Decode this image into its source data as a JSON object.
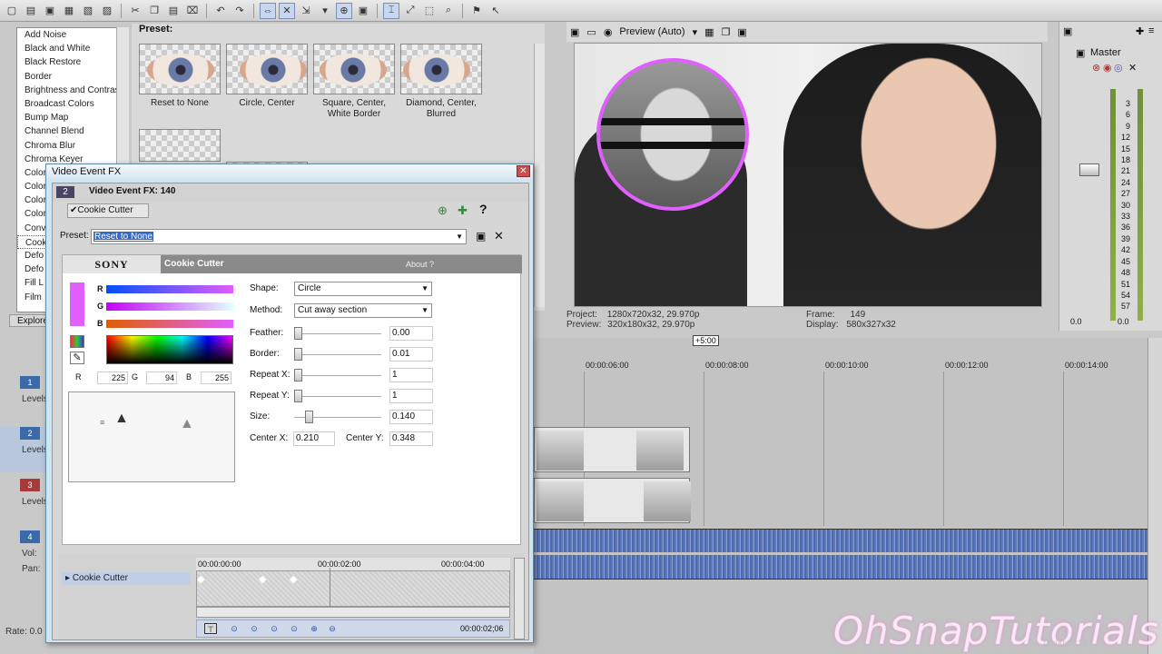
{
  "plugin_list": {
    "items": [
      "Add Noise",
      "Black and White",
      "Black Restore",
      "Border",
      "Brightness and Contrast",
      "Broadcast Colors",
      "Bump Map",
      "Channel Blend",
      "Chroma Blur",
      "Chroma Keyer",
      "Color",
      "Color",
      "Color",
      "Color",
      "Conv",
      "Cook",
      "Defo",
      "Defo",
      "Fill L",
      "Film"
    ],
    "explorer_tab": "Explore"
  },
  "presets": {
    "label": "Preset:",
    "items": [
      {
        "label": "Reset to None"
      },
      {
        "label": "Circle, Center"
      },
      {
        "label": "Square, Center, White Border"
      },
      {
        "label": "Diamond, Center, Blurred"
      }
    ]
  },
  "preview": {
    "mode_label": "Preview (Auto)",
    "project_label": "Project:",
    "project_value": "1280x720x32, 29.970p",
    "preview_label": "Preview:",
    "preview_value": "320x180x32, 29.970p",
    "frame_label": "Frame:",
    "frame_value": "149",
    "display_label": "Display:",
    "display_value": "580x327x32"
  },
  "master": {
    "label": "Master",
    "scale": [
      "3",
      "6",
      "9",
      "12",
      "15",
      "18",
      "21",
      "24",
      "27",
      "30",
      "33",
      "36",
      "39",
      "42",
      "45",
      "48",
      "51",
      "54",
      "57"
    ],
    "bottom_left": "0.0",
    "bottom_right": "0.0"
  },
  "timeline": {
    "cursor_label": "+5:00",
    "ruler": [
      "00:00:06:00",
      "00:00:08:00",
      "00:00:10:00",
      "00:00:12:00",
      "00:00:14:00"
    ],
    "tracks": [
      {
        "num": "1",
        "label": "Levels",
        "color": "#3a6aa8"
      },
      {
        "num": "2",
        "label": "Levels",
        "color": "#3a6aa8"
      },
      {
        "num": "3",
        "label": "Levels",
        "color": "#a83a3a"
      },
      {
        "num": "4",
        "label": "Vol:",
        "label2": "Pan:",
        "color": "#3a6aa8"
      }
    ],
    "rate_label": "Rate: 0.0"
  },
  "dialog": {
    "title": "Video Event FX",
    "close": "✕",
    "chain_num": "2",
    "chain_title": "Video Event FX: 140",
    "plugin_tab": "Cookie Cutter",
    "preset_label": "Preset:",
    "preset_value": "Reset to None",
    "brand": "SONY",
    "plugin_name": "Cookie Cutter",
    "about": "About ?",
    "color": {
      "r": "225",
      "g": "94",
      "b": "255",
      "hex": "#e15eff"
    },
    "params": {
      "shape_label": "Shape:",
      "shape_value": "Circle",
      "method_label": "Method:",
      "method_value": "Cut away section",
      "feather_label": "Feather:",
      "feather_value": "0.00",
      "border_label": "Border:",
      "border_value": "0.01",
      "repeatx_label": "Repeat X:",
      "repeatx_value": "1",
      "repeaty_label": "Repeat Y:",
      "repeaty_value": "1",
      "size_label": "Size:",
      "size_value": "0.140",
      "centerx_label": "Center X:",
      "centerx_value": "0.210",
      "centery_label": "Center Y:",
      "centery_value": "0.348"
    },
    "keyframes": {
      "track_label": "Cookie Cutter",
      "ruler": [
        "00:00:00:00",
        "00:00:02:00",
        "00:00:04:00"
      ],
      "time": "00:00:02;06"
    }
  },
  "watermark": "OhSnapTutorials",
  "mini_timecode": "00:00:00;29"
}
